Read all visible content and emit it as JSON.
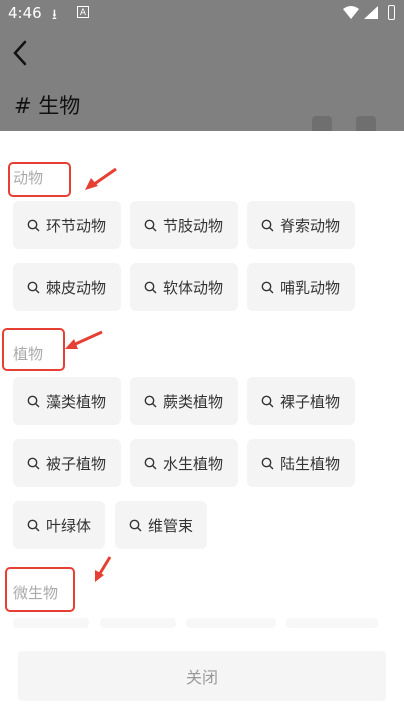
{
  "status_bar": {
    "time": "4:46"
  },
  "header": {
    "title": "# 生物"
  },
  "sections": [
    {
      "title": "动物",
      "chips": [
        "环节动物",
        "节肢动物",
        "脊索动物",
        "棘皮动物",
        "软体动物",
        "哺乳动物"
      ]
    },
    {
      "title": "植物",
      "chips": [
        "藻类植物",
        "蕨类植物",
        "裸子植物",
        "被子植物",
        "水生植物",
        "陆生植物",
        "叶绿体",
        "维管束"
      ]
    },
    {
      "title": "微生物",
      "chips": []
    }
  ],
  "footer": {
    "close_label": "关闭"
  },
  "colors": {
    "overlay": "#808080",
    "highlight": "#e54033",
    "chip_bg": "#f4f4f4"
  }
}
